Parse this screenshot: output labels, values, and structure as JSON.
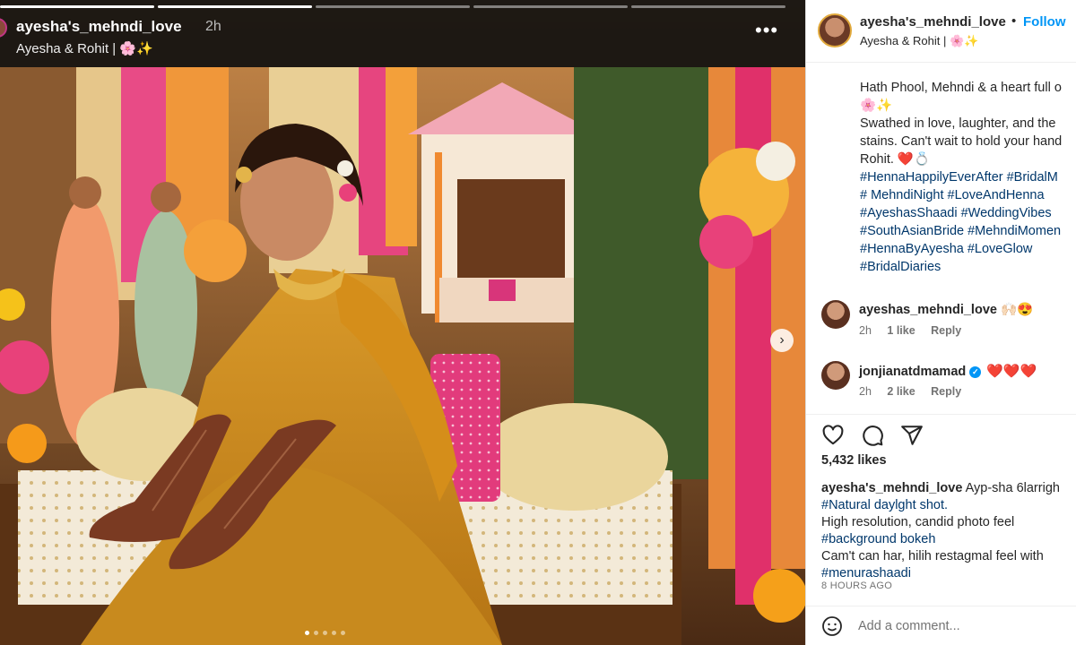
{
  "story": {
    "username": "ayesha's_mehndi_love",
    "time": "2h",
    "subtitle": "Ayesha & Rohit | 🌸✨",
    "more_icon": "more-horizontal-icon",
    "segments": [
      true,
      true,
      false,
      false,
      false
    ],
    "next_icon": "chevron-right-icon"
  },
  "post": {
    "header": {
      "username": "ayesha's_mehndi_love",
      "dot": "•",
      "follow_label": "Follow",
      "subtitle": "Ayesha & Rohit | 🌸✨"
    },
    "caption_lines": [
      "Hath Phool, Mehndi & a heart full o",
      "🌸✨",
      "Swathed in love, laughter, and the",
      "stains. Can't wait to hold your hand",
      "Rohit. ❤️💍"
    ],
    "hashtag_lines": [
      "#HennaHappilyEverAfter #BridalM",
      "# MehndiNight #LoveAndHenna",
      "#AyeshasShaadi #WeddingVibes",
      "#SouthAsianBride #MehndiMomen",
      "#HennaByAyesha #LoveGlow",
      "#BridalDiaries"
    ],
    "comments": [
      {
        "user": "ayeshas_mehndi_love",
        "text": "🙌🏻😍",
        "time": "2h",
        "likes": "1 like",
        "reply": "Reply",
        "verified": false
      },
      {
        "user": "jonjianatdmamad",
        "text": "❤️❤️❤️",
        "time": "2h",
        "likes": "2 like",
        "reply": "Reply",
        "verified": true
      }
    ],
    "likes": "5,432 likes",
    "post_caption": {
      "user": "ayesha's_mehndi_love",
      "first_text": "Ayp-sha 6larrigh",
      "line2": "#Natural daylght shot.",
      "line3": "High resolution, candid photo feel",
      "line4": "#background bokeh",
      "line5": "Cam't can har, hilih restagmal feel with",
      "line6": "#menurashaadi"
    },
    "time_ago": "8 HOURS AGO",
    "add_comment_placeholder": "Add a comment...",
    "icons": [
      "heart-icon",
      "comment-icon",
      "share-icon",
      "emoji-icon"
    ]
  },
  "colors": {
    "link": "#0095f6",
    "hashtag": "#00376b",
    "heart": "#e0245e"
  }
}
